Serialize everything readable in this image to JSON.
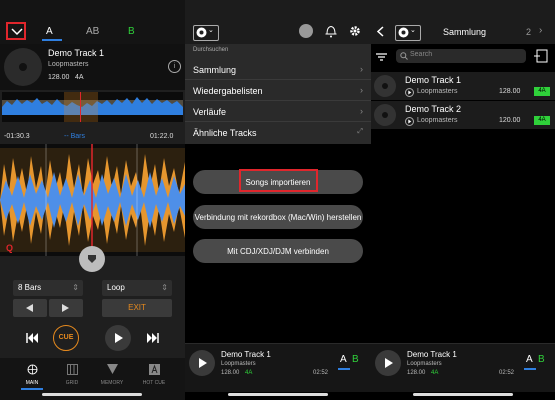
{
  "colors": {
    "accent_red": "#e0262c",
    "green": "#2fd13a",
    "blue": "#2f7fe0",
    "orange": "#e68a1e"
  },
  "deck": {
    "tabs": [
      "A",
      "AB",
      "B"
    ],
    "track_title": "Demo Track 1",
    "artist": "Loopmasters",
    "bpm": "128.00",
    "key": "4A",
    "time_elapsed": "-01:30.3",
    "bars_label": "-- Bars",
    "time_remaining": "01:22.0",
    "q_label": "Q",
    "loop_length": "8 Bars",
    "loop_mode": "Loop",
    "exit_label": "EXIT",
    "cue_label": "CUE",
    "nav": [
      {
        "label": "MAIN",
        "icon": "globe-icon"
      },
      {
        "label": "GRID",
        "icon": "grid-icon"
      },
      {
        "label": "MEMORY",
        "icon": "memory-icon"
      },
      {
        "label": "HOT CUE",
        "icon": "hotcue-icon"
      }
    ]
  },
  "browse": {
    "section": "Durchsuchen",
    "menu": [
      "Sammlung",
      "Wiedergabelisten",
      "Verläufe",
      "Ähnliche Tracks"
    ],
    "import_button": "Songs importieren",
    "connect_rekordbox": "Verbindung mit rekordbox (Mac/Win) herstellen",
    "connect_cdj": "Mit CDJ/XDJ/DJM verbinden"
  },
  "collection": {
    "title": "Sammlung",
    "count": "2",
    "search_placeholder": "Search",
    "tracks": [
      {
        "title": "Demo Track 1",
        "artist": "Loopmasters",
        "bpm": "128.00",
        "key": "4A"
      },
      {
        "title": "Demo Track 2",
        "artist": "Loopmasters",
        "bpm": "120.00",
        "key": "4A"
      }
    ]
  },
  "mini_player": {
    "title": "Demo Track 1",
    "artist": "Loopmasters",
    "bpm": "128.00",
    "key": "4A",
    "time": "02:52",
    "deck_a": "A",
    "deck_b": "B"
  }
}
